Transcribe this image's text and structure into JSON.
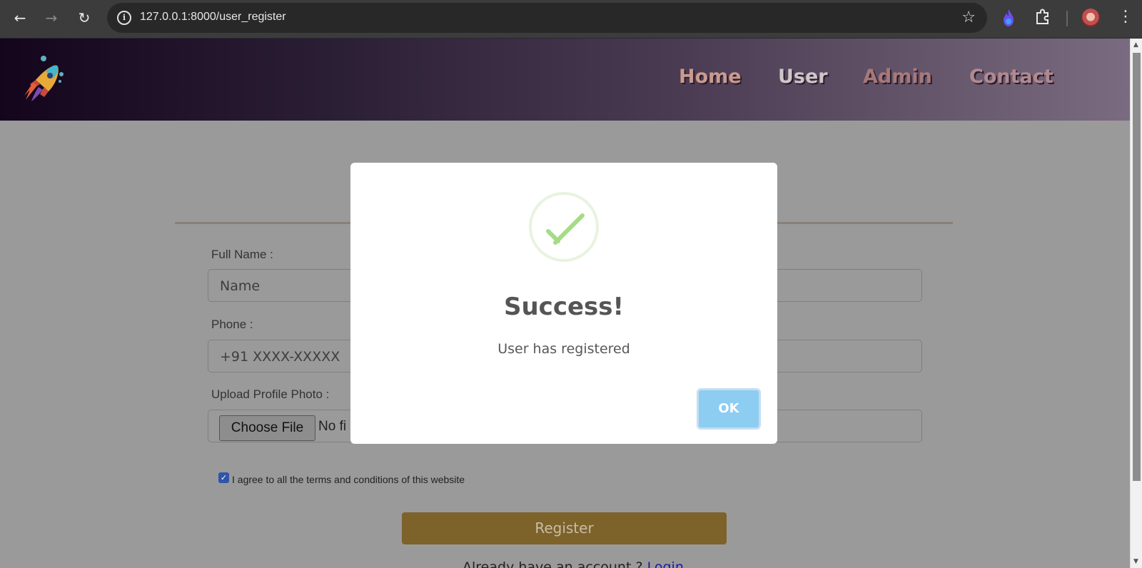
{
  "browser": {
    "url": "127.0.0.1:8000/user_register",
    "icons": [
      "back-arrow-icon",
      "forward-arrow-icon",
      "reload-icon",
      "site-info-icon",
      "bookmark-star-icon",
      "flame-extension-icon",
      "extensions-puzzle-icon",
      "profile-avatar",
      "menu-kebab-icon"
    ]
  },
  "header": {
    "logo": "rocket-logo",
    "nav": [
      {
        "label": "Home"
      },
      {
        "label": "User"
      },
      {
        "label": "Admin"
      },
      {
        "label": "Contact"
      }
    ]
  },
  "form": {
    "full_name_label": "Full Name :",
    "full_name_placeholder": "Name",
    "phone_label": "Phone :",
    "phone_placeholder": "+91 XXXX-XXXXX",
    "upload_label": "Upload Profile Photo :",
    "choose_file_label": "Choose File",
    "no_file_text": "No fi",
    "terms_text": "I agree to all the terms and conditions of this website",
    "terms_checked": true,
    "register_label": "Register",
    "already_text": "Already have an account ?",
    "login_link": "Login"
  },
  "modal": {
    "title": "Success!",
    "message": "User has registered",
    "ok_label": "OK",
    "icon": "success-check-icon",
    "colors": {
      "check": "#a5dc86",
      "ok_button": "#8ccdf1"
    }
  }
}
